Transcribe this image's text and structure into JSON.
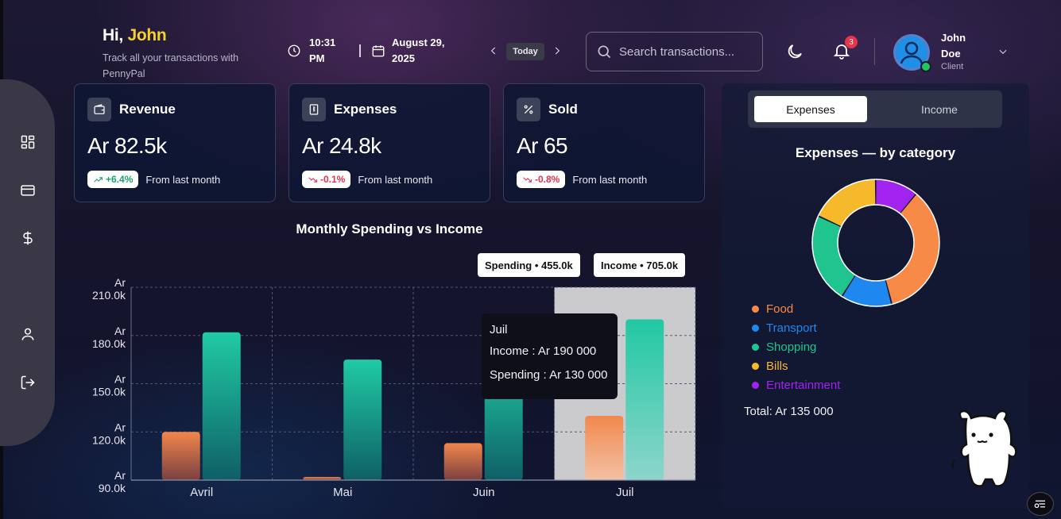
{
  "greeting": {
    "hi": "Hi,",
    "name": "John",
    "subtitle": "Track all your transactions with PennyPal"
  },
  "header": {
    "time": "10:31 PM",
    "date": "August 29, 2025",
    "today_label": "Today",
    "search_placeholder": "Search transactions...",
    "notification_count": "3",
    "user_name": "John Doe",
    "user_role": "Client"
  },
  "sidebar": {
    "items": [
      {
        "icon": "dashboard-icon"
      },
      {
        "icon": "card-icon"
      },
      {
        "icon": "dollar-icon"
      },
      {
        "icon": "user-icon"
      },
      {
        "icon": "logout-icon"
      }
    ]
  },
  "stats": [
    {
      "icon": "wallet-icon",
      "title": "Revenue",
      "value": "Ar 82.5k",
      "change": "+6.4%",
      "trend": "up",
      "note": "From last month"
    },
    {
      "icon": "receipt-icon",
      "title": "Expenses",
      "value": "Ar 24.8k",
      "change": "-0.1%",
      "trend": "down",
      "note": "From last month"
    },
    {
      "icon": "percent-icon",
      "title": "Sold",
      "value": "Ar 65",
      "change": "-0.8%",
      "trend": "down",
      "note": "From last month"
    }
  ],
  "chart": {
    "title": "Monthly Spending vs Income",
    "spending_chip": "Spending • 455.0k",
    "income_chip": "Income • 705.0k",
    "tooltip": {
      "month": "Juil",
      "income": "Income : Ar 190 000",
      "spending": "Spending : Ar 130 000"
    }
  },
  "chart_data": {
    "type": "bar",
    "categories": [
      "Avril",
      "Mai",
      "Juin",
      "Juil"
    ],
    "series": [
      {
        "name": "Spending",
        "values": [
          120000,
          92000,
          113000,
          130000
        ],
        "color": "#f0854e"
      },
      {
        "name": "Income",
        "values": [
          182000,
          165000,
          170000,
          190000
        ],
        "color": "#1fc7a1"
      }
    ],
    "y_ticks": [
      {
        "value": 90000,
        "line1": "Ar",
        "line2": "90.0k"
      },
      {
        "value": 120000,
        "line1": "Ar",
        "line2": "120.0k"
      },
      {
        "value": 150000,
        "line1": "Ar",
        "line2": "150.0k"
      },
      {
        "value": 180000,
        "line1": "Ar",
        "line2": "180.0k"
      },
      {
        "value": 210000,
        "line1": "Ar",
        "line2": "210.0k"
      }
    ],
    "ylim": [
      90000,
      210000
    ],
    "highlight_category": "Juil",
    "grid": true
  },
  "panel": {
    "tab_active": "Expenses",
    "tab_inactive": "Income",
    "title": "Expenses — by category",
    "categories": [
      {
        "name": "Food",
        "color": "#f78a47",
        "share": 0.35
      },
      {
        "name": "Transport",
        "color": "#1e88f0",
        "share": 0.13
      },
      {
        "name": "Shopping",
        "color": "#1fc48e",
        "share": 0.23
      },
      {
        "name": "Bills",
        "color": "#f5b92b",
        "share": 0.18
      },
      {
        "name": "Entertainment",
        "color": "#a223f0",
        "share": 0.11
      }
    ],
    "total": "Total: Ar 135 000"
  }
}
